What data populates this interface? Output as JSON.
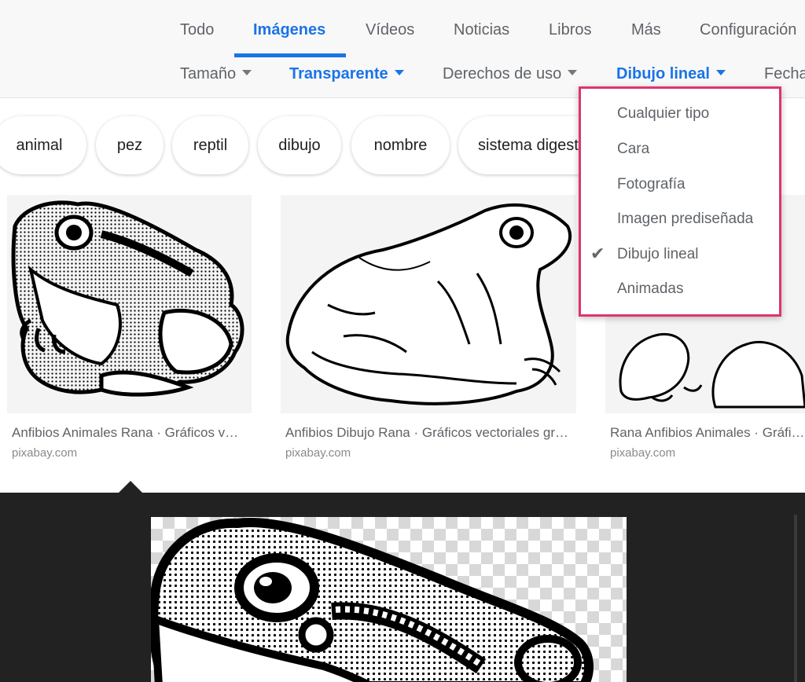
{
  "tabs": [
    {
      "label": "Todo"
    },
    {
      "label": "Imágenes"
    },
    {
      "label": "Vídeos"
    },
    {
      "label": "Noticias"
    },
    {
      "label": "Libros"
    },
    {
      "label": "Más"
    },
    {
      "label": "Configuración"
    }
  ],
  "tools": [
    {
      "label": "Tamaño"
    },
    {
      "label": "Transparente"
    },
    {
      "label": "Derechos de uso"
    },
    {
      "label": "Dibujo lineal"
    },
    {
      "label": "Fecha"
    }
  ],
  "chips": [
    "animal",
    "pez",
    "reptil",
    "dibujo",
    "nombre",
    "sistema digestivo"
  ],
  "results": [
    {
      "title": "Anfibios Animales Rana · Gráficos vectoriales gratis en Pixabay",
      "source": "pixabay.com"
    },
    {
      "title": "Anfibios Dibujo Rana · Gráficos vectoriales gratis en Pixabay",
      "source": "pixabay.com"
    },
    {
      "title": "Rana Anfibios Animales · Gráficos vectoriales gratis en Pixabay",
      "source": "pixabay.com"
    }
  ],
  "dropdown": {
    "items": [
      "Cualquier tipo",
      "Cara",
      "Fotografía",
      "Imagen prediseñada",
      "Dibujo lineal",
      "Animadas"
    ],
    "selected": "Dibujo lineal",
    "check_icon": "checkmark-icon"
  },
  "colors": {
    "accent": "#1a73e8",
    "highlight": "#e0336f",
    "preview_bg": "#222222"
  }
}
